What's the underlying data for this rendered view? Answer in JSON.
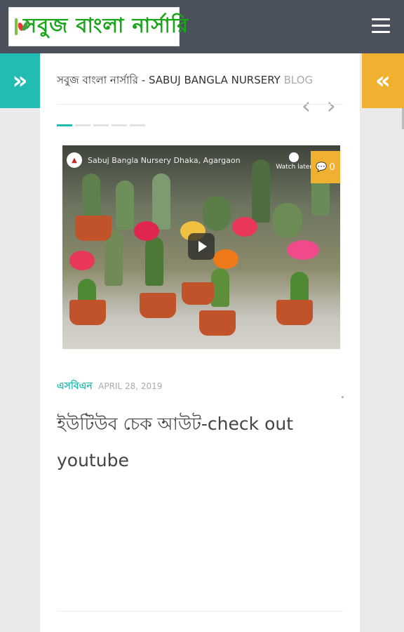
{
  "header": {
    "logo_text": "সবুজ বাংলা নার্সারি",
    "menu_icon": "hamburger-icon"
  },
  "sidebar": {
    "left_icon": "double-chevron-right-icon",
    "left_glyph": "»",
    "right_icon": "double-chevron-left-icon",
    "right_glyph": "«"
  },
  "blog": {
    "title_main": "সবুজ বাংলা নার্সারি - SABUJ BANGLA NURSERY",
    "title_light": "BLOG"
  },
  "slider": {
    "prev_glyph": "‹",
    "next_glyph": "›"
  },
  "video": {
    "channel_title": "Sabuj Bangla Nursery Dhaka, Agargaon",
    "watch_later": "Watch later",
    "comment_count": "0"
  },
  "post": {
    "category": "এসবিএন",
    "date": "APRIL 28, 2019",
    "title": "ইউটিউব চেক আউট-check out youtube"
  },
  "colors": {
    "topbar": "#4b515c",
    "teal_accent": "#22bcb3",
    "orange_accent": "#f0b030",
    "logo_green": "#1aa51a"
  }
}
